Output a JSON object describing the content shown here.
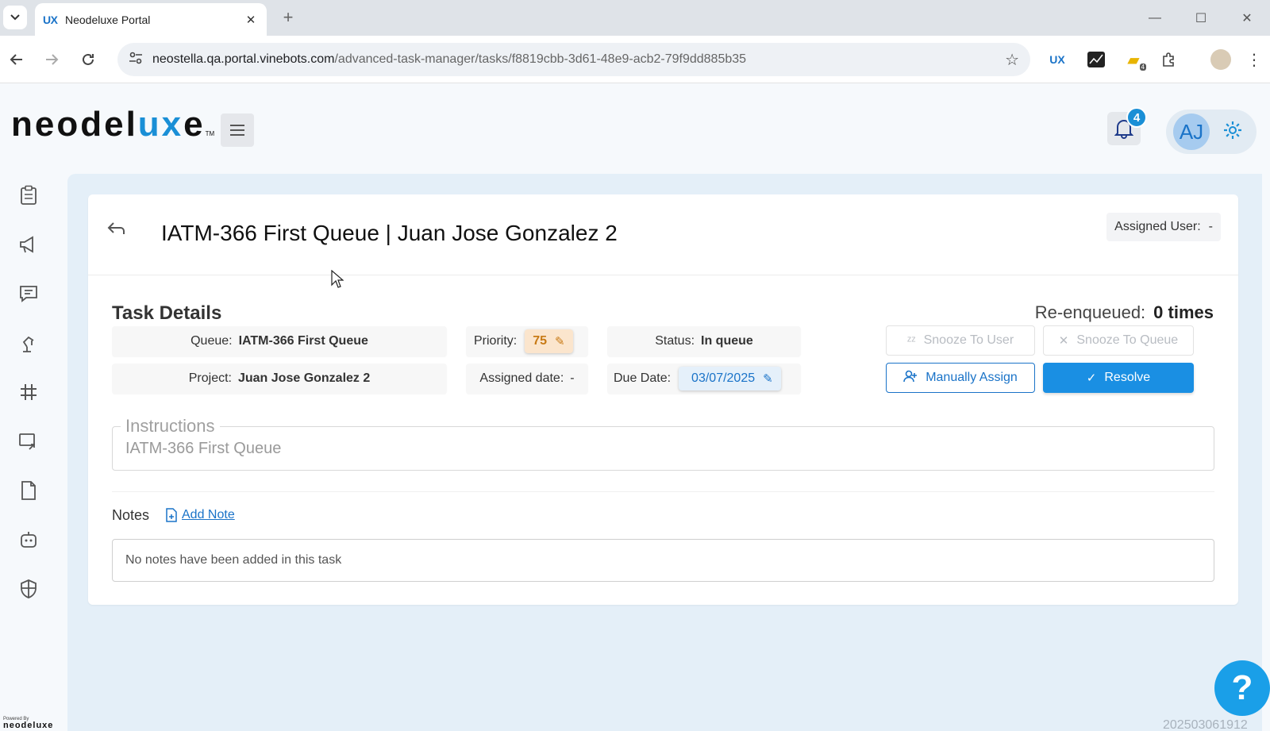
{
  "browser": {
    "tab_title": "Neodeluxe Portal",
    "tab_favicon": "UX",
    "url_host": "neostella.qa.portal.vinebots.com",
    "url_path": "/advanced-task-manager/tasks/f8819cbb-3d61-48e9-acb2-79f9dd885b35",
    "extensions": [
      "ux-extension-icon",
      "graph-extension-icon",
      "folder-extension-icon",
      "puzzle-icon",
      "profile-icon"
    ],
    "folder_badge": "4"
  },
  "header": {
    "logo_main": "neodel",
    "logo_accent": "ux",
    "logo_end": "e",
    "logo_tm": "TM",
    "notification_count": "4",
    "avatar_initials": "AJ"
  },
  "sidebar": {
    "items": [
      "clipboard-icon",
      "megaphone-icon",
      "chat-icon",
      "robot-arm-icon",
      "grid-icon",
      "screen-share-icon",
      "document-icon",
      "bot-face-icon",
      "shield-icon"
    ],
    "powered_by": "Powered By",
    "powered_logo": "neodeluxe"
  },
  "task": {
    "title": "IATM-366 First Queue | Juan Jose Gonzalez 2",
    "assigned_user_label": "Assigned User:",
    "assigned_user_value": "-",
    "section_title": "Task Details",
    "reenqueued_label": "Re-enqueued:",
    "reenqueued_value": "0 times",
    "queue_label": "Queue:",
    "queue_value": "IATM-366 First Queue",
    "project_label": "Project:",
    "project_value": "Juan Jose Gonzalez 2",
    "priority_label": "Priority:",
    "priority_value": "75",
    "assigned_date_label": "Assigned date:",
    "assigned_date_value": "-",
    "status_label": "Status:",
    "status_value": "In queue",
    "due_date_label": "Due Date:",
    "due_date_value": "03/07/2025"
  },
  "actions": {
    "snooze_user": "Snooze To User",
    "snooze_queue": "Snooze To Queue",
    "manually_assign": "Manually Assign",
    "resolve": "Resolve"
  },
  "instructions": {
    "legend": "Instructions",
    "value": "IATM-366 First Queue"
  },
  "notes": {
    "title": "Notes",
    "add_note": "Add Note",
    "empty_message": "No notes have been added in this task"
  },
  "footer": {
    "version": "202503061912"
  },
  "colors": {
    "accent": "#1a8fe3",
    "brand_blue": "#1a8fd6",
    "priority_bg": "#fbe5cd",
    "priority_text": "#c87a15"
  }
}
